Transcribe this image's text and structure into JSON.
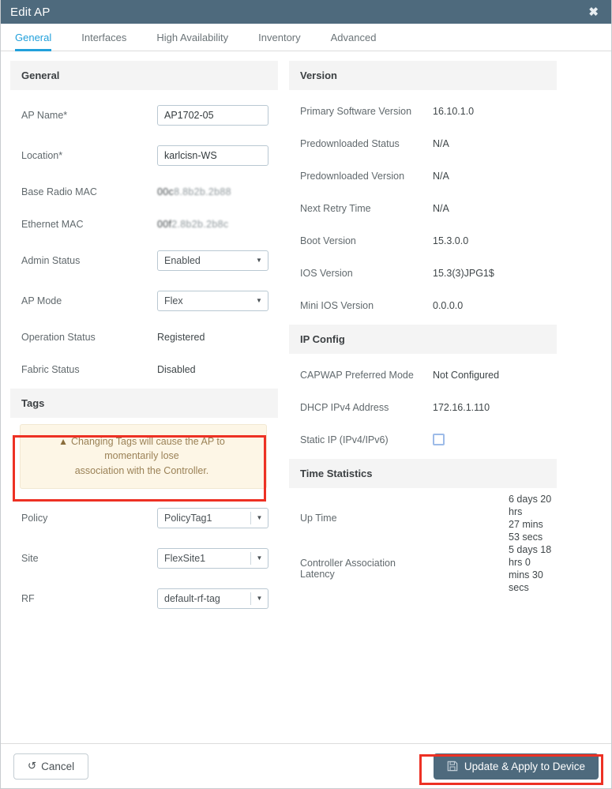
{
  "window": {
    "title": "Edit AP",
    "close_icon": "close-icon",
    "close_glyph": "✖"
  },
  "tabs": [
    {
      "label": "General",
      "active": true
    },
    {
      "label": "Interfaces",
      "active": false
    },
    {
      "label": "High Availability",
      "active": false
    },
    {
      "label": "Inventory",
      "active": false
    },
    {
      "label": "Advanced",
      "active": false
    }
  ],
  "left": {
    "general": {
      "heading": "General",
      "ap_name": {
        "label": "AP Name*",
        "value": "AP1702-05"
      },
      "location": {
        "label": "Location*",
        "value": "karlcisn-WS"
      },
      "base_radio_mac": {
        "label": "Base Radio MAC",
        "value_prefix": "00c",
        "value_redacted": "8.8b2b.2b88"
      },
      "ethernet_mac": {
        "label": "Ethernet MAC",
        "value_prefix": "00f",
        "value_redacted": "2.8b2b.2b8c"
      },
      "admin_status": {
        "label": "Admin Status",
        "value": "Enabled"
      },
      "ap_mode": {
        "label": "AP Mode",
        "value": "Flex"
      },
      "operation_status": {
        "label": "Operation Status",
        "value": "Registered"
      },
      "fabric_status": {
        "label": "Fabric Status",
        "value": "Disabled"
      }
    },
    "tags": {
      "heading": "Tags",
      "warning_icon": "warning-triangle-icon",
      "warning_line1": "Changing Tags will cause the AP to momentarily lose",
      "warning_line2": "association with the Controller.",
      "policy": {
        "label": "Policy",
        "value": "PolicyTag1"
      },
      "site": {
        "label": "Site",
        "value": "FlexSite1"
      },
      "rf": {
        "label": "RF",
        "value": "default-rf-tag"
      }
    }
  },
  "right": {
    "version": {
      "heading": "Version",
      "rows": [
        {
          "label": "Primary Software Version",
          "value": "16.10.1.0"
        },
        {
          "label": "Predownloaded Status",
          "value": "N/A"
        },
        {
          "label": "Predownloaded Version",
          "value": "N/A"
        },
        {
          "label": "Next Retry Time",
          "value": "N/A"
        },
        {
          "label": "Boot Version",
          "value": "15.3.0.0"
        },
        {
          "label": "IOS Version",
          "value": "15.3(3)JPG1$"
        },
        {
          "label": "Mini IOS Version",
          "value": "0.0.0.0"
        }
      ]
    },
    "ip_config": {
      "heading": "IP Config",
      "capwap": {
        "label": "CAPWAP Preferred Mode",
        "value": "Not Configured"
      },
      "dhcp": {
        "label": "DHCP IPv4 Address",
        "value": "172.16.1.110"
      },
      "static_ip": {
        "label": "Static IP (IPv4/IPv6)",
        "checked": false
      }
    },
    "time_statistics": {
      "heading": "Time Statistics",
      "up_time": {
        "label": "Up Time",
        "line1": "6 days 20 hrs",
        "line2": "27 mins 53 secs"
      },
      "latency": {
        "label": "Controller Association Latency",
        "line1": "5 days 18 hrs 0",
        "line2": "mins 30 secs"
      }
    }
  },
  "footer": {
    "cancel": {
      "label": "Cancel",
      "icon": "undo-arrow-icon",
      "glyph": "↺"
    },
    "update": {
      "label": "Update & Apply to Device",
      "icon": "save-disk-icon"
    }
  },
  "colors": {
    "titlebar": "#4e6a7d",
    "accent": "#21a0db",
    "highlight": "#ed3124",
    "panel_head": "#f4f4f4",
    "warning_bg": "#fdf6e6"
  }
}
